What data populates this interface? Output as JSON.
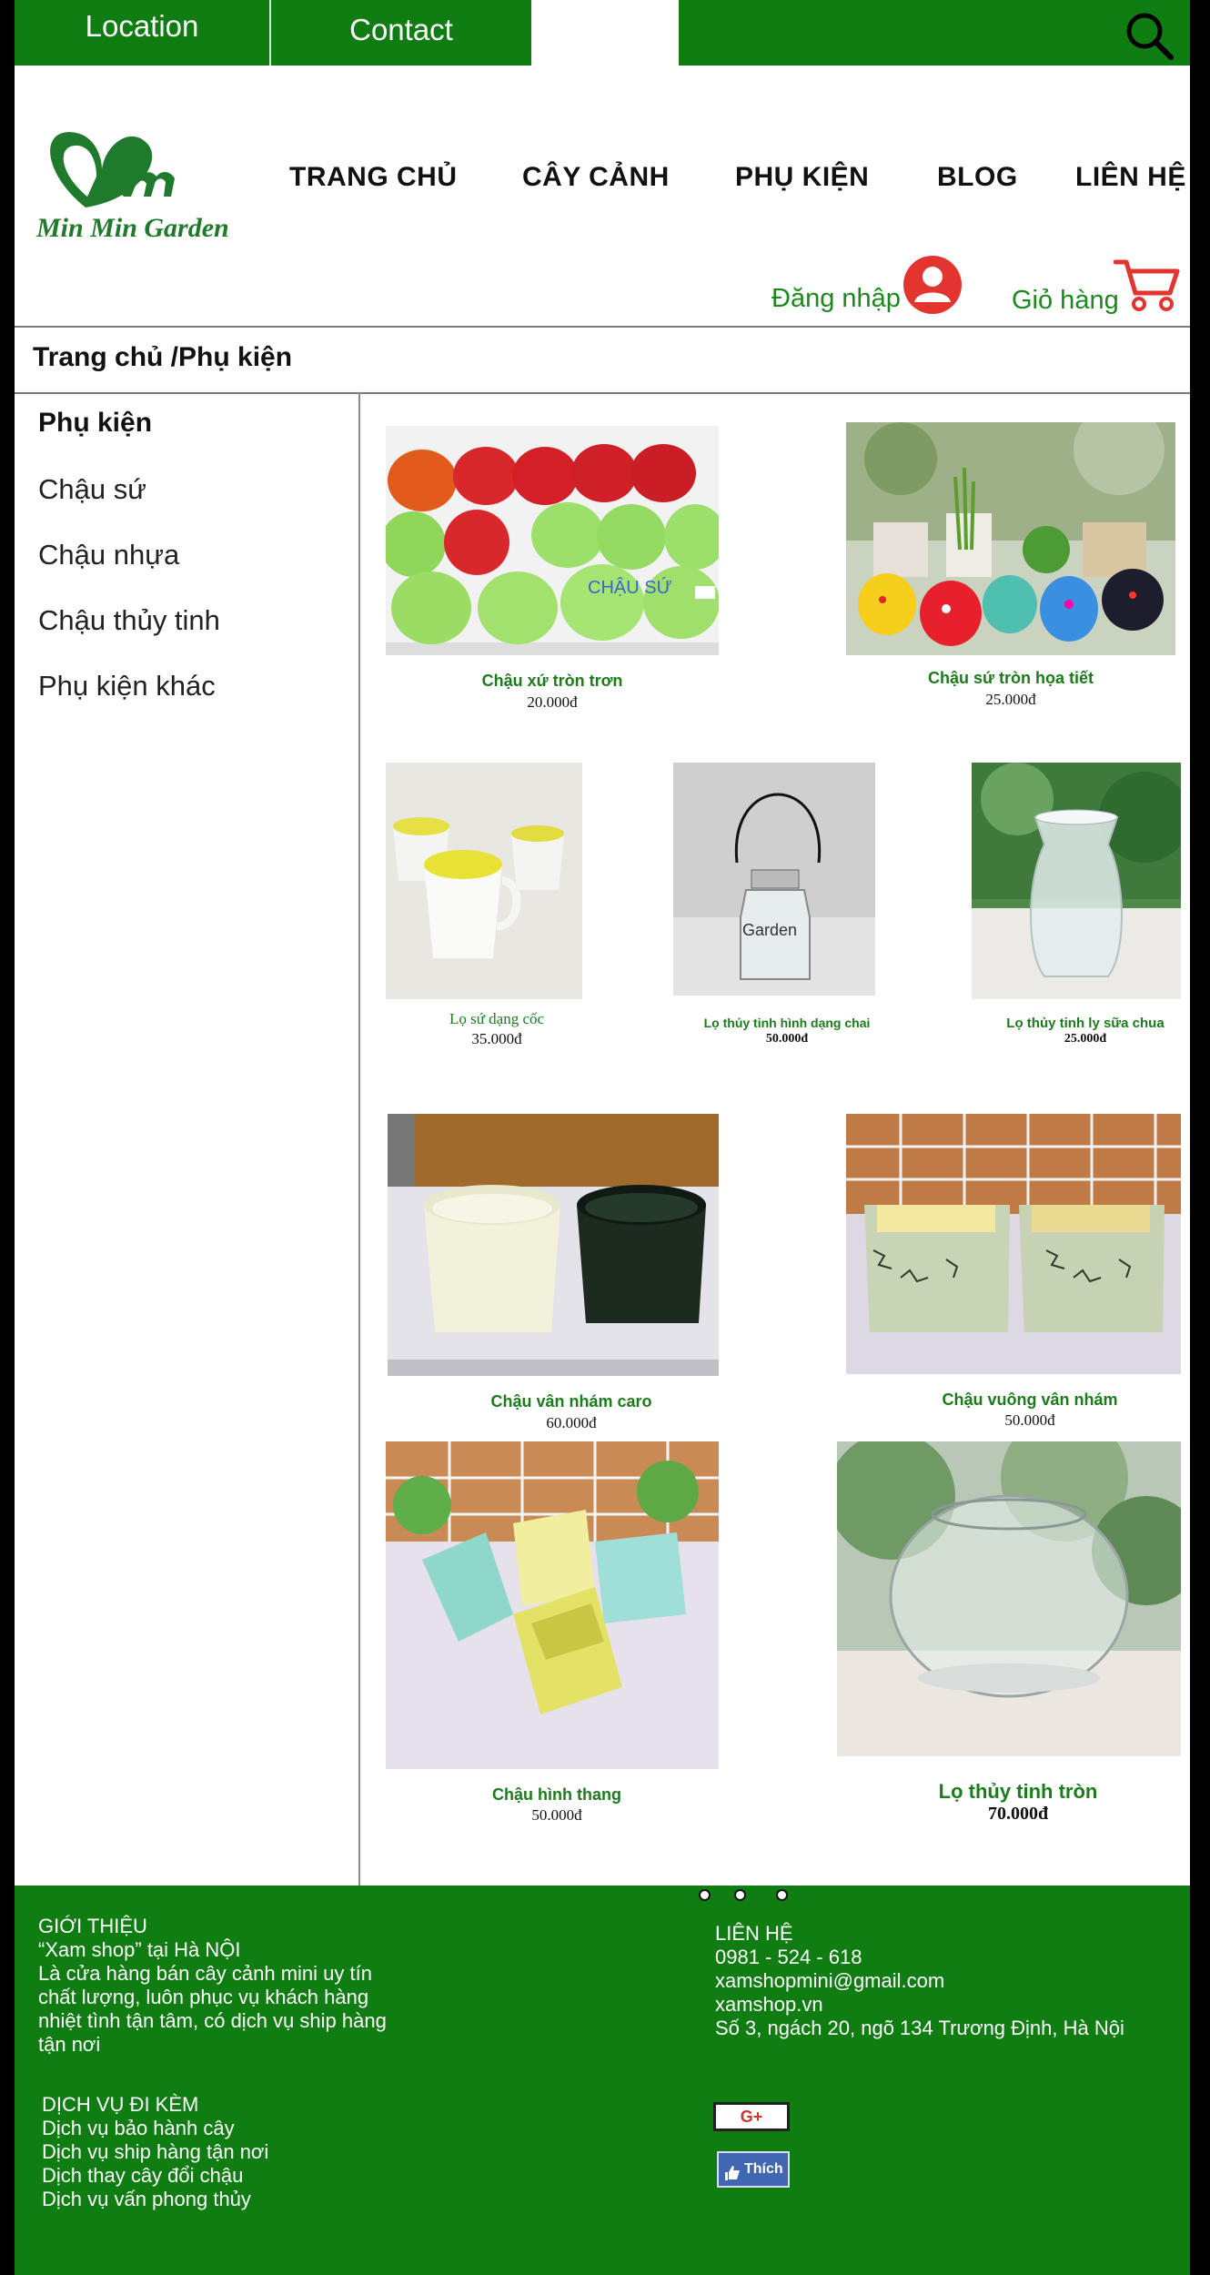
{
  "topbar": {
    "location_label": "Location",
    "contact_label": "Contact"
  },
  "brand": {
    "logo_text": "Min Min Garden"
  },
  "nav": [
    {
      "label": "TRANG CHỦ"
    },
    {
      "label": "CÂY CẢNH"
    },
    {
      "label": "PHỤ KIỆN"
    },
    {
      "label": "BLOG"
    },
    {
      "label": "LIÊN HỆ"
    }
  ],
  "account": {
    "login_label": "Đăng nhập",
    "cart_label": "Giỏ hàng"
  },
  "breadcrumb": "Trang chủ /Phụ kiện",
  "sidebar": {
    "title": "Phụ kiện",
    "items": [
      {
        "label": "Chậu sứ"
      },
      {
        "label": "Chậu nhựa"
      },
      {
        "label": "Chậu thủy tinh"
      },
      {
        "label": "Phụ kiện khác"
      }
    ]
  },
  "products": [
    {
      "name": "Chậu  xứ tròn trơn",
      "price": "20.000đ",
      "image": "green-red-ceramic-pots",
      "image_text": "CHẬU SỨ"
    },
    {
      "name": "Chậu sứ tròn họa tiết",
      "price": "25.000đ",
      "image": "patterned-pots-with-plants"
    },
    {
      "name": "Lọ sứ dạng cốc",
      "price": "35.000đ",
      "image": "yellow-cups"
    },
    {
      "name": "Lọ thủy tinh hình dạng chai",
      "price": "50.000đ",
      "image": "glass-bottle-hanging",
      "image_text": "Garden"
    },
    {
      "name": "Lọ thủy tinh ly sữa chua",
      "price": "25.000đ",
      "image": "yogurt-glass-jar"
    },
    {
      "name": "Chậu vân nhám caro",
      "price": "60.000đ",
      "image": "white-and-black-round-pots"
    },
    {
      "name": "Chậu vuông vân nhám",
      "price": "50.000đ",
      "image": "crackle-square-pots"
    },
    {
      "name": "Chậu hình thang",
      "price": "50.000đ",
      "image": "pastel-trapezoid-pots"
    },
    {
      "name": "Lọ thủy tinh tròn",
      "price": "70.000đ",
      "image": "round-glass-bowl"
    }
  ],
  "footer": {
    "about_title": "GIỚI THIỆU",
    "about_lines": [
      "“Xam shop” tại Hà NỘI",
      "Là cửa hàng bán cây cảnh mini uy tín",
      "chất lượng, luôn phục vụ khách hàng",
      "nhiệt tình tận tâm, có dịch vụ ship hàng",
      "tận nơi"
    ],
    "services_title": "DỊCH VỤ ĐI KÈM",
    "services": [
      "Dịch vụ bảo hành cây",
      "Dịch vụ ship hàng tận nơi",
      "Dịch thay cây đổi chậu",
      "Dịch vụ vấn phong thủy"
    ],
    "contact_title": "LIÊN HỆ",
    "contact_lines": [
      "0981 - 524 - 618",
      "xamshopmini@gmail.com",
      "xamshop.vn",
      "Số 3, ngách 20, ngõ 134 Trương Định, Hà Nội"
    ],
    "gplus_label": "G+",
    "like_label": "Thích"
  },
  "colors": {
    "brand_green": "#0f7d12",
    "accent_red": "#e3342f",
    "product_name_green": "#1a7d1a"
  }
}
